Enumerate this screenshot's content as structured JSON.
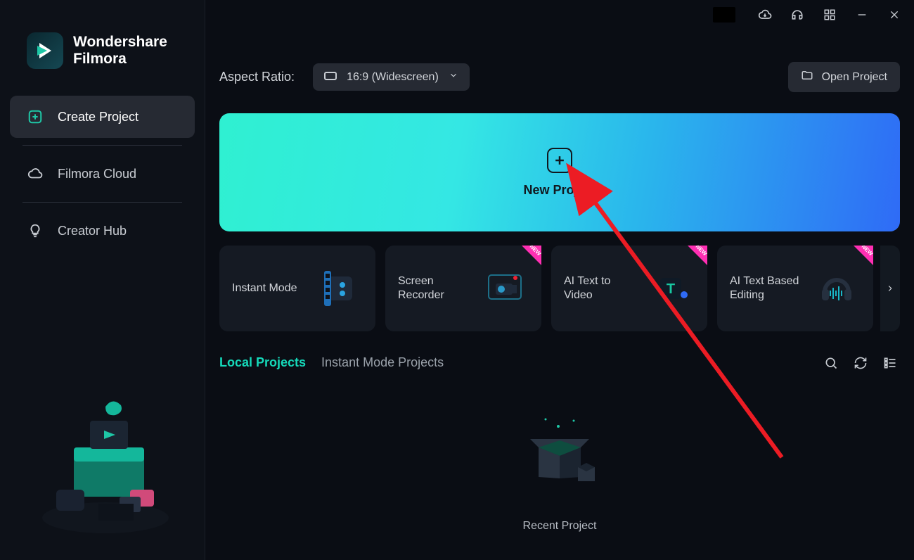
{
  "brand": {
    "line1": "Wondershare",
    "line2": "Filmora"
  },
  "sidebar": {
    "items": [
      {
        "label": "Create Project"
      },
      {
        "label": "Filmora Cloud"
      },
      {
        "label": "Creator Hub"
      }
    ]
  },
  "toprow": {
    "aspect_label": "Aspect Ratio:",
    "aspect_value": "16:9 (Widescreen)",
    "open_label": "Open Project"
  },
  "hero": {
    "label": "New Project"
  },
  "modes": [
    {
      "label": "Instant Mode",
      "new": false
    },
    {
      "label": "Screen Recorder",
      "new": true
    },
    {
      "label": "AI Text to Video",
      "new": true
    },
    {
      "label": "AI Text Based Editing",
      "new": true
    }
  ],
  "tabs": {
    "local": "Local Projects",
    "instant": "Instant Mode Projects"
  },
  "recent": {
    "label": "Recent Project"
  },
  "colors": {
    "accent": "#15d9ba",
    "hero_grad_from": "#2ff0d1",
    "hero_grad_to": "#2f6bf6",
    "new_badge": "#ff2fb3",
    "arrow": "#ec1c24"
  }
}
